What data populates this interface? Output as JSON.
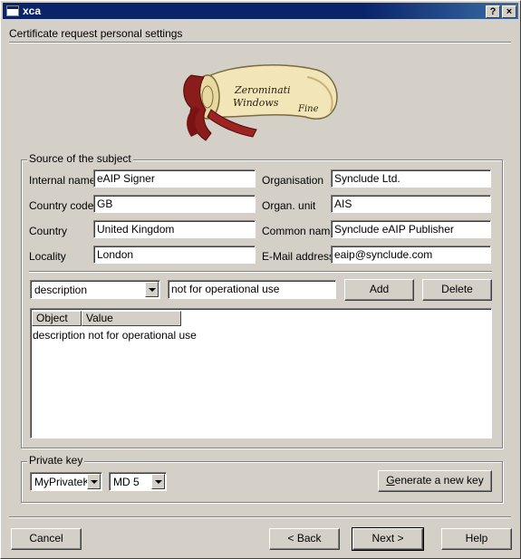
{
  "window": {
    "title": "xca",
    "help_button": "?",
    "close_button": "×"
  },
  "header": {
    "subtitle": "Certificate request personal settings"
  },
  "subject": {
    "group_label": "Source of the subject",
    "internal_name_label": "Internal name",
    "internal_name": "eAIP Signer",
    "country_code_label": "Country code",
    "country_code": "GB",
    "country_label": "Country",
    "country": "United Kingdom",
    "locality_label": "Locality",
    "locality": "London",
    "organisation_label": "Organisation",
    "organisation": "Synclude Ltd.",
    "org_unit_label": "Organ. unit",
    "org_unit": "AIS",
    "common_name_label": "Common name",
    "common_name": "Synclude eAIP Publisher",
    "email_label": "E-Mail address",
    "email": "eaip@synclude.com",
    "object_combo_value": "description",
    "object_value_input": "not for operational use",
    "add_button": "Add",
    "delete_button": "Delete",
    "table": {
      "columns": [
        "Object",
        "Value"
      ],
      "rows": [
        {
          "object": "description",
          "value": "not for operational use"
        }
      ]
    }
  },
  "private_key": {
    "group_label": "Private key",
    "key_combo_value": "MyPrivateK",
    "hash_combo_value": "MD 5",
    "generate_button_prefix": "G",
    "generate_button_rest": "enerate a new key"
  },
  "footer": {
    "cancel_button": "Cancel",
    "back_button": "< Back",
    "next_button": "Next >",
    "help_button": "Help"
  },
  "logo": {
    "line1": "Zerominati",
    "line2": "Windows",
    "line3": "Fine"
  }
}
